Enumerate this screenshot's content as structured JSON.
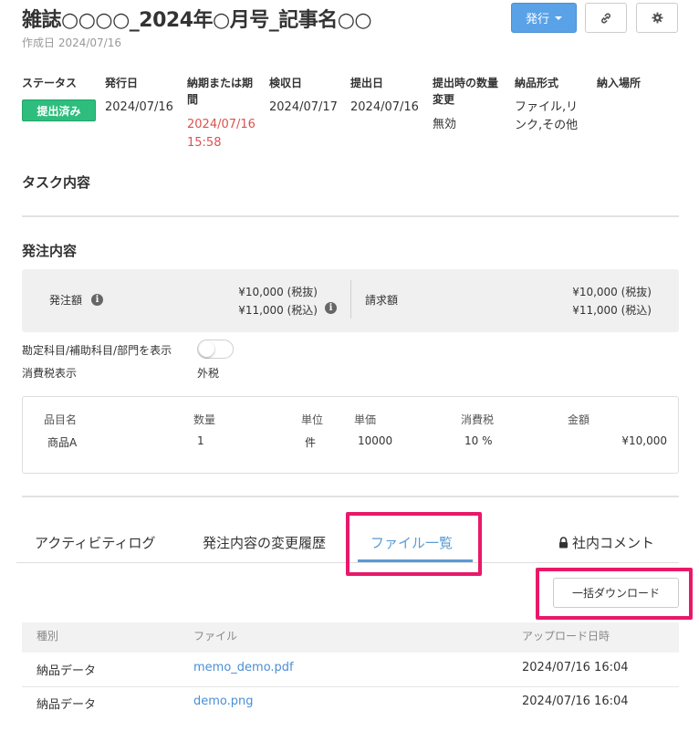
{
  "header": {
    "title": "雑誌○○○○_2024年○月号_記事名○○",
    "created_label": "作成日 2024/07/16",
    "issue_button": "発行",
    "link_icon": "link-icon",
    "gear_icon": "gear-icon"
  },
  "info": {
    "status_label": "ステータス",
    "status_value": "提出済み",
    "issue_date_label": "発行日",
    "issue_date_value": "2024/07/16",
    "deadline_label_1": "納期または期",
    "deadline_label_2": "間",
    "deadline_value_1": "2024/07/16",
    "deadline_value_2": "15:58",
    "inspection_label": "検収日",
    "inspection_value": "2024/07/17",
    "submit_label": "提出日",
    "submit_value": "2024/07/16",
    "qty_change_label_1": "提出時の数量",
    "qty_change_label_2": "変更",
    "qty_change_value": "無効",
    "delivery_format_label": "納品形式",
    "delivery_format_value_1": "ファイル,リ",
    "delivery_format_value_2": "ンク,その他",
    "delivery_place_label": "納入場所"
  },
  "task": {
    "title": "タスク内容"
  },
  "order": {
    "title": "発注内容",
    "amount_label": "発注額",
    "amount_excl": "¥10,000 (税抜)",
    "amount_incl": "¥11,000 (税込)",
    "invoice_label": "請求額",
    "invoice_excl": "¥10,000 (税抜)",
    "invoice_incl": "¥11,000 (税込)",
    "show_accounts_label": "勘定科目/補助科目/部門を表示",
    "tax_display_label": "消費税表示",
    "tax_display_value": "外税"
  },
  "items": {
    "headers": [
      "品目名",
      "数量",
      "単位",
      "単価",
      "消費税",
      "金額"
    ],
    "rows": [
      [
        "商品A",
        "1",
        "件",
        "10000",
        "10 %",
        "¥10,000"
      ]
    ]
  },
  "tabs": {
    "activity": "アクティビティログ",
    "history": "発注内容の変更履歴",
    "files": "ファイル一覧",
    "internal": "社内コメント",
    "lock_icon": "lock-icon"
  },
  "files": {
    "bulk_download": "一括ダウンロード",
    "headers": [
      "種別",
      "ファイル",
      "アップロード日時"
    ],
    "rows": [
      [
        "納品データ",
        "memo_demo.pdf",
        "2024/07/16 16:04"
      ],
      [
        "納品データ",
        "demo.png",
        "2024/07/16 16:04"
      ]
    ]
  },
  "colors": {
    "accent": "#5a9bd5",
    "status_green": "#2ebd7d",
    "highlight": "#e8196a",
    "deadline_red": "#d9534f"
  }
}
